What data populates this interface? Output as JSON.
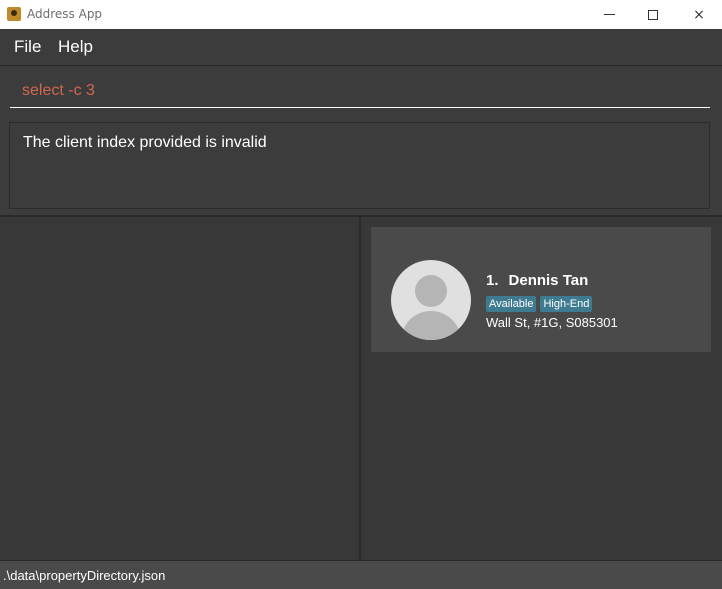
{
  "window": {
    "title": "Address App",
    "controls": {
      "minimize": "minimize",
      "maximize": "maximize",
      "close": "×"
    }
  },
  "menu": {
    "items": [
      "File",
      "Help"
    ]
  },
  "command": {
    "value": "select -c 3"
  },
  "result": {
    "message": "The client index provided is invalid"
  },
  "clients": [
    {
      "index": "1.",
      "name": "Dennis Tan",
      "tags": [
        "Available",
        "High-End"
      ],
      "address": "Wall St, #1G, S085301"
    }
  ],
  "status": {
    "file_path": ".\\data\\propertyDirectory.json"
  },
  "colors": {
    "background": "#3c3c3c",
    "command_text": "#d06651",
    "tag": "#3e7b91",
    "card": "#4a4a4a"
  },
  "icons": {
    "app": "address-book-icon",
    "avatar": "default-user-avatar"
  }
}
